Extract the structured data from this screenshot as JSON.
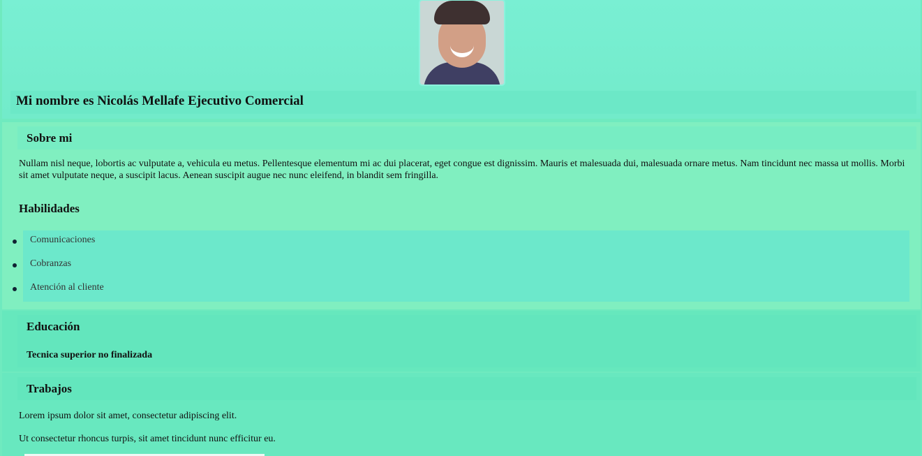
{
  "profile": {
    "title": "Mi nombre es Nicolás Mellafe Ejecutivo Comercial"
  },
  "about": {
    "heading": "Sobre mi",
    "text": "Nullam nisl neque, lobortis ac vulputate a, vehicula eu metus. Pellentesque elementum mi ac dui placerat, eget congue est dignissim. Mauris et malesuada dui, malesuada ornare metus. Nam tincidunt nec massa ut mollis. Morbi sit amet vulputate neque, a suscipit lacus. Aenean suscipit augue nec nunc eleifend, in blandit sem fringilla."
  },
  "skills": {
    "heading": "Habilidades",
    "items": [
      "Comunicaciones",
      "Cobranzas",
      "Atención al cliente"
    ]
  },
  "education": {
    "heading": "Educación",
    "detail": "Tecnica superior no finalizada"
  },
  "jobs": {
    "heading": "Trabajos",
    "line1": "Lorem ipsum dolor sit amet, consectetur adipiscing elit.",
    "line2": "Ut consectetur rhoncus turpis, sit amet tincidunt nunc efficitur eu."
  },
  "colors": {
    "header_bg": "#79efd3",
    "section_bg": "#80efc0",
    "panel_bg": "#6ce8cb"
  }
}
